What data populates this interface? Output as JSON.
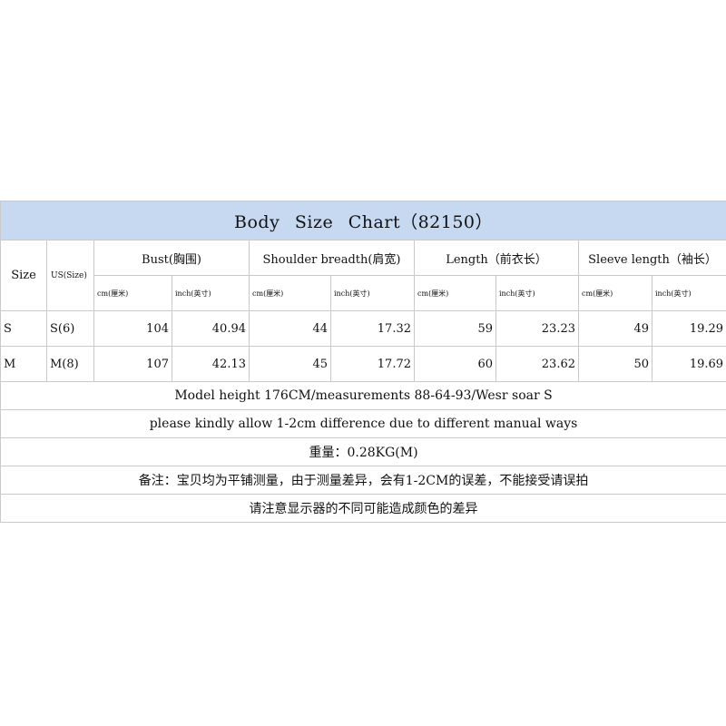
{
  "title": "Body  Size  Chart（82150）",
  "headers": {
    "size": "Size",
    "us_size": "US(Size)",
    "groups": [
      {
        "label": "Bust(胸围)",
        "units": [
          "cm(厘米)",
          "inch(英寸)"
        ]
      },
      {
        "label": "Shoulder breadth(肩宽)",
        "units": [
          "cm(厘米)",
          "inch(英寸)"
        ]
      },
      {
        "label": "Length（前衣长）",
        "units": [
          "cm(厘米)",
          "inch(英寸)"
        ]
      },
      {
        "label": "Sleeve length（袖长）",
        "units": [
          "cm(厘米)",
          "inch(英寸)"
        ]
      }
    ]
  },
  "rows": [
    {
      "size": "S",
      "us": "S(6)",
      "values": [
        "104",
        "40.94",
        "44",
        "17.32",
        "59",
        "23.23",
        "49",
        "19.29"
      ]
    },
    {
      "size": "M",
      "us": "M(8)",
      "values": [
        "107",
        "42.13",
        "45",
        "17.72",
        "60",
        "23.62",
        "50",
        "19.69"
      ]
    }
  ],
  "notes": [
    "Model height 176CM/measurements 88-64-93/Wesr soar S",
    "please kindly allow 1-2cm difference due to different manual ways",
    "重量：0.28KG(M)",
    "备注：宝贝均为平铺测量，由于测量差异，会有1-2CM的误差，不能接受请误拍",
    "请注意显示器的不同可能造成颜色的差异"
  ],
  "colors": {
    "title_background": "#c6d9f1",
    "grid_line": "#c9c9c9"
  }
}
